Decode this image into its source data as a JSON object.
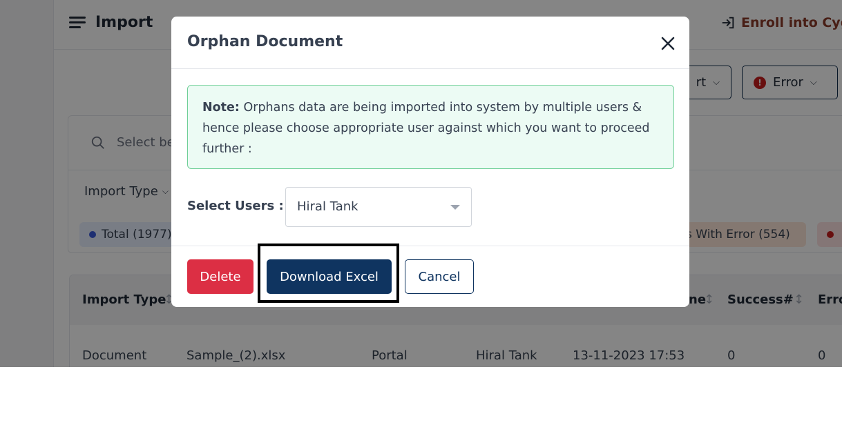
{
  "app": {
    "title": "Import",
    "enroll_label": "Enroll into Cyg",
    "export_label": "rt",
    "error_label": "Error",
    "search_placeholder": "Select be",
    "import_type_filter": "Import Type",
    "pills": {
      "total": "Total (1977)",
      "with_error": "s With Error (554)"
    },
    "table": {
      "headers": [
        "Import Type",
        "ne",
        "Success#",
        "Erro"
      ],
      "row": [
        "Document",
        "Sample_(2).xlsx",
        "Portal",
        "Hiral Tank",
        "13-11-2023 17:53",
        "0",
        "0"
      ]
    }
  },
  "modal": {
    "title": "Orphan Document",
    "note_label": "Note:",
    "note_text": "Orphans data are being imported into system by multiple users & hence please choose appropriate user against which you want to proceed further :",
    "select_label": "Select Users :",
    "select_value": "Hiral Tank",
    "buttons": {
      "delete": "Delete",
      "download": "Download Excel",
      "cancel": "Cancel"
    }
  },
  "colors": {
    "primary": "#0f3460",
    "danger": "#dc2f44",
    "note_bg": "#ecfbf4",
    "note_border": "#6fcf97"
  }
}
